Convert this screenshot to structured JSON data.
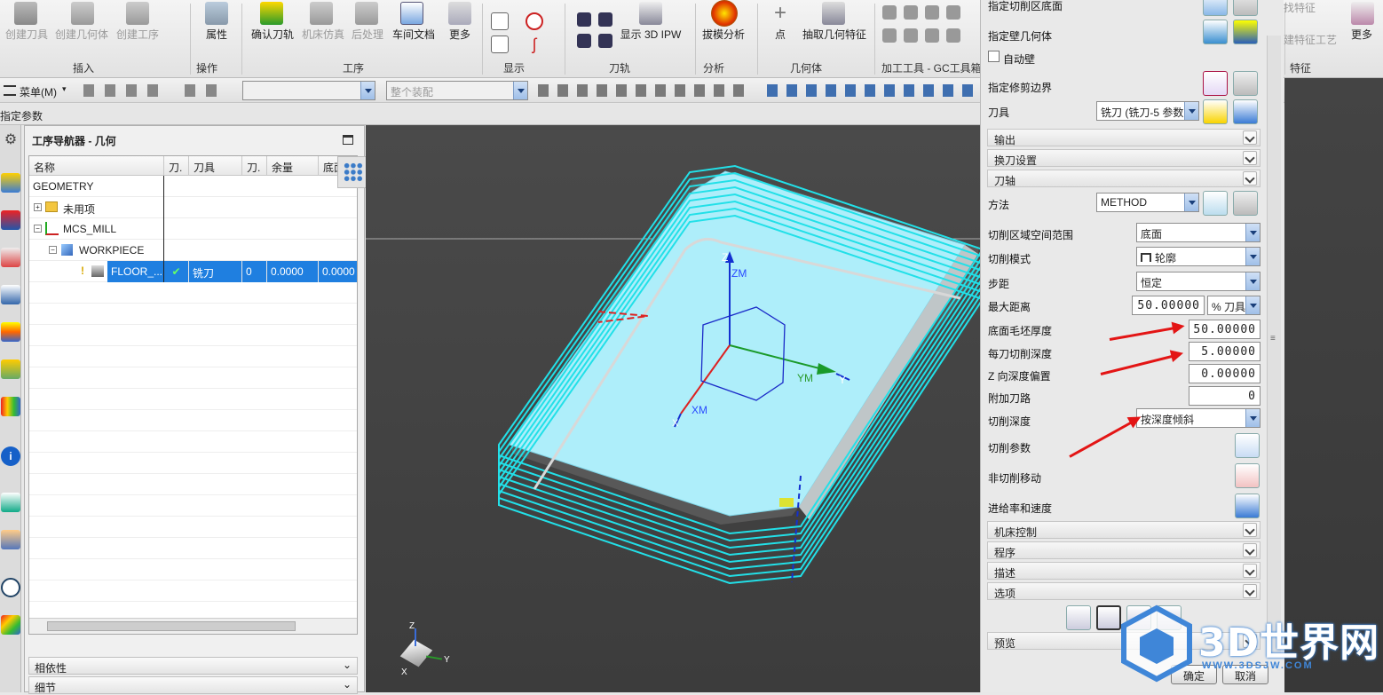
{
  "ribbon": {
    "buttons": {
      "create_tool": "创建刀具",
      "create_geometry": "创建几何体",
      "create_operation": "创建工序",
      "properties": "属性",
      "confirm_path": "确认刀轨",
      "machine_sim": "机床仿真",
      "post_process": "后处理",
      "shop_doc": "车间文档",
      "more1": "更多",
      "show_3d_ipw": "显示 3D IPW",
      "draft_analysis": "拔模分析",
      "point": "点",
      "extract_geometry": "抽取几何特征",
      "more2": "更多"
    },
    "groups": {
      "insert": "插入",
      "operation": "操作",
      "process": "工序",
      "display": "显示",
      "toolpath": "刀轨",
      "analysis": "分析",
      "geometry": "几何体",
      "machining_tools": "加工工具 - GC工具箱",
      "feature": "特征"
    },
    "partial_right_top": "找特征",
    "partial_right_mid": "建特征工艺"
  },
  "toolbar2": {
    "menu_label": "菜单(M)",
    "filter_placeholder": "",
    "assembly_scope": "整个装配"
  },
  "header_bar": {
    "title": "指定参数"
  },
  "navigator": {
    "title": "工序导航器 - 几何",
    "columns": [
      "名称",
      "刀.",
      "刀具",
      "刀.",
      "余量",
      "底面"
    ],
    "rows": [
      {
        "name": "GEOMETRY",
        "check": "",
        "tool": "",
        "num": "",
        "stock": "",
        "floor": ""
      },
      {
        "name": "未用项",
        "check": "",
        "tool": "",
        "num": "",
        "stock": "",
        "floor": ""
      },
      {
        "name": "MCS_MILL",
        "check": "",
        "tool": "",
        "num": "",
        "stock": "",
        "floor": ""
      },
      {
        "name": "WORKPIECE",
        "check": "",
        "tool": "",
        "num": "",
        "stock": "",
        "floor": ""
      },
      {
        "name": "FLOOR_...",
        "check": "✔",
        "tool": "铣刀",
        "num": "0",
        "stock": "0.0000",
        "floor": "0.0000"
      }
    ],
    "dependency_label": "相依性",
    "details_label": "细节"
  },
  "viewport": {
    "axis_z": "Z",
    "axis_zm": "ZM",
    "axis_ym": "YM",
    "axis_y": "Y",
    "axis_xm": "XM",
    "axis_x": "X",
    "triad_z": "Z",
    "triad_y": "Y",
    "triad_x": "X"
  },
  "panel": {
    "specify_cut_floor": "指定切削区底面",
    "specify_wall_geometry": "指定壁几何体",
    "auto_wall": "自动壁",
    "specify_trim_boundary": "指定修剪边界",
    "tool_label": "刀具",
    "tool_value": "铣刀 (铣刀-5 参数",
    "sections_top": [
      "输出",
      "换刀设置",
      "刀轴"
    ],
    "method_label": "方法",
    "method_value": "METHOD",
    "cut_region_label": "切削区域空间范围",
    "cut_region_value": "底面",
    "cut_pattern_label": "切削模式",
    "cut_pattern_value": "轮廓",
    "stepover_label": "步距",
    "stepover_value": "恒定",
    "max_distance_label": "最大距离",
    "max_distance_value": "50.00000",
    "max_distance_unit": "% 刀具",
    "floor_blank_label": "底面毛坯厚度",
    "floor_blank_value": "50.00000",
    "depth_per_cut_label": "每刀切削深度",
    "depth_per_cut_value": "5.00000",
    "z_offset_label": "Z 向深度偏置",
    "z_offset_value": "0.00000",
    "extra_passes_label": "附加刀路",
    "extra_passes_value": "0",
    "cut_depth_label": "切削深度",
    "cut_depth_value": "按深度倾斜",
    "cut_params_label": "切削参数",
    "non_cut_moves_label": "非切削移动",
    "feeds_speeds_label": "进给率和速度",
    "sections_bottom": [
      "机床控制",
      "程序",
      "描述",
      "选项"
    ],
    "preview_label": "预览",
    "ok_label": "确定",
    "cancel_label": "取消"
  },
  "watermark": {
    "brand": "3D世界网",
    "url": "WWW.3DSJW.COM"
  },
  "colors": {
    "viewport_bg": "#444444",
    "part_top": "#aeeefa",
    "toolpath": "#22e0e8",
    "accent_blue": "#0b62d6",
    "selected_row": "#1f7fe0",
    "annotation_red": "#e31515"
  }
}
